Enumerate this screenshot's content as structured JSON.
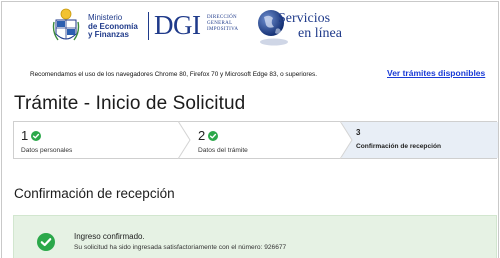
{
  "header": {
    "ministry_line1": "Ministerio",
    "ministry_line2": "de Economía",
    "ministry_line3": "y Finanzas",
    "dgi": "DGI",
    "dgi_sub_line1": "Dirección",
    "dgi_sub_line2": "General",
    "dgi_sub_line3": "Impositiva",
    "services_line1": "Servicios",
    "services_line2": "en línea"
  },
  "notice": {
    "text": "Recomendamos el uso de los navegadores Chrome 80, Firefox 70 y Microsoft Edge 83, o superiores.",
    "link": "Ver trámites disponibles"
  },
  "page": {
    "title": "Trámite - Inicio de Solicitud",
    "subtitle": "Confirmación de recepción"
  },
  "steps": [
    {
      "number": "1",
      "label": "Datos personales",
      "status": "done"
    },
    {
      "number": "2",
      "label": "Datos del trámite",
      "status": "done"
    },
    {
      "number": "3",
      "label": "Confirmación de recepción",
      "status": "current"
    }
  ],
  "success": {
    "title": "Ingreso confirmado.",
    "message": "Su solicitud ha sido ingresada satisfactoriamente con el número: 926677"
  },
  "colors": {
    "brand_blue": "#1f3a8a",
    "link": "#1a3bd6",
    "success_green": "#2ba84a",
    "success_bg": "#e6f2e4",
    "current_step_bg": "#e8eef6"
  }
}
